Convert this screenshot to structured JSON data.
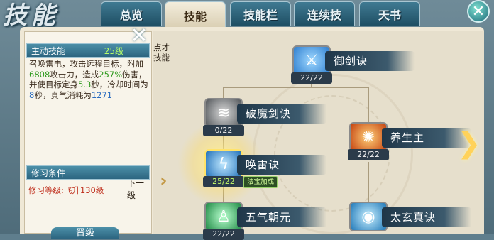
{
  "window": {
    "title": "技能"
  },
  "tabs": [
    {
      "label": "总览"
    },
    {
      "label": "技能",
      "active": true
    },
    {
      "label": "技能栏"
    },
    {
      "label": "连续技"
    },
    {
      "label": "天书"
    }
  ],
  "detail": {
    "header_label": "主动技能",
    "level": "25级",
    "description_parts": [
      "召唤雷电，攻击远程目标，附加",
      "6808",
      "攻击力，造成",
      "257%",
      "伤害，并使目标定身",
      "5.3",
      "秒，冷却时间为",
      "8",
      "秒，真气消耗为",
      "1271"
    ],
    "next_level_label": "下一级",
    "requirement_header": "修习条件",
    "requirement_text": "修习等级:飞升130级",
    "bottom_button_label": "晋级",
    "partial_text_line1": "点才",
    "partial_text_line2": "技能"
  },
  "skills": [
    {
      "name": "御剑诀",
      "count": "22/22",
      "icon": "sword-icon",
      "color": "#2f7fd0"
    },
    {
      "name": "破魔剑诀",
      "count": "0/22",
      "icon": "blade-icon",
      "color": "#6a6f74"
    },
    {
      "name": "养生主",
      "count": "22/22",
      "icon": "fire-icon",
      "color": "#d46a1a"
    },
    {
      "name": "唤雷诀",
      "count": "25/22",
      "icon": "lightning-icon",
      "color": "#2a8fd8",
      "badge": "法宝加成"
    },
    {
      "name": "五气朝元",
      "count": "22/22",
      "icon": "qi-icon",
      "color": "#2aa65a"
    },
    {
      "name": "太玄真诀",
      "count": "",
      "icon": "orb-icon",
      "color": "#2a9ad8"
    }
  ],
  "colors": {
    "accent": "#2c6580",
    "highlight_green": "#2f9a1e",
    "highlight_blue": "#2a6cc0",
    "requirement_red": "#c0301e"
  }
}
